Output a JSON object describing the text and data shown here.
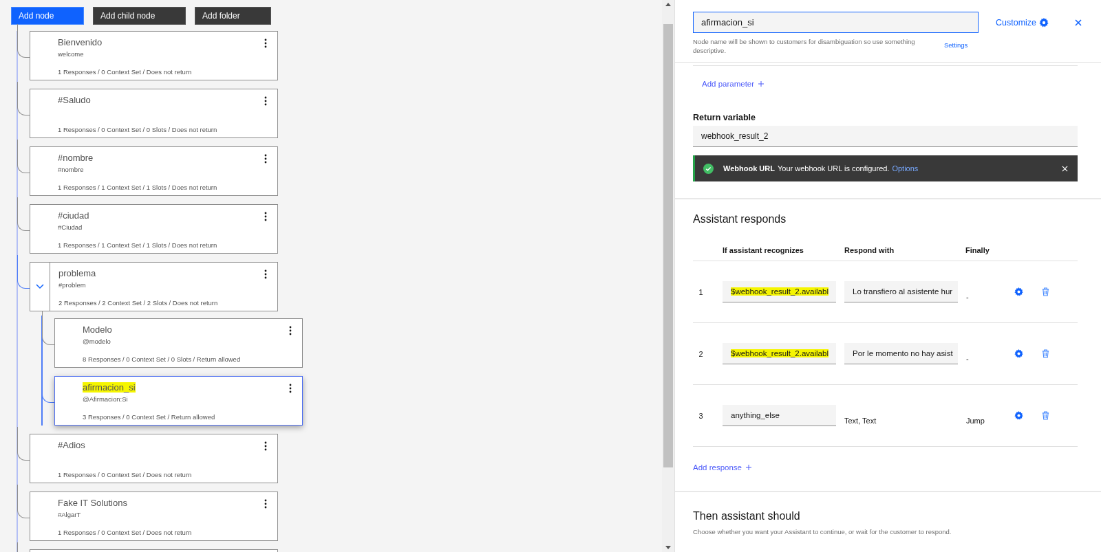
{
  "toolbar": [
    {
      "label": "Add node",
      "kind": "primary"
    },
    {
      "label": "Add child node",
      "kind": "dark"
    },
    {
      "label": "Add folder",
      "kind": "dark"
    }
  ],
  "nodes": [
    {
      "title": "Bienvenido",
      "condition": "welcome",
      "summary": "1 Responses / 0 Context Set / Does not return",
      "selected": false,
      "highlighted": false
    },
    {
      "title": "#Saludo",
      "summary": "1 Responses / 0 Context Set / 0 Slots / Does not return",
      "selected": false,
      "highlighted": false
    },
    {
      "title": "#nombre",
      "condition": "#nombre",
      "summary": "1 Responses / 1 Context Set / 1 Slots / Does not return",
      "selected": false,
      "highlighted": false
    },
    {
      "title": "#ciudad",
      "condition": "#Ciudad",
      "summary": "1 Responses / 1 Context Set / 1 Slots / Does not return",
      "selected": false,
      "highlighted": false
    },
    {
      "title": "problema",
      "condition": "#problem",
      "summary": "2 Responses / 2 Context Set / 2 Slots / Does not return",
      "selected": false,
      "highlighted": false,
      "expanded": true,
      "children": [
        {
          "title": "Modelo",
          "condition": "@modelo",
          "summary": "8 Responses / 0 Context Set / 0 Slots / Return allowed",
          "selected": false,
          "highlighted": false
        },
        {
          "title": "afirmacion_si",
          "condition": "@Afirmacion:Si",
          "summary": "3 Responses / 0 Context Set / Return allowed",
          "selected": true,
          "highlighted": true
        }
      ]
    },
    {
      "title": "#Adios",
      "summary": "1 Responses / 0 Context Set / Does not return",
      "selected": false,
      "highlighted": false
    },
    {
      "title": "Fake IT Solutions",
      "condition": "#AlgarT",
      "summary": "1 Responses / 0 Context Set / Does not return",
      "selected": false,
      "highlighted": false
    },
    {
      "selected": false,
      "highlighted": false
    }
  ],
  "panel": {
    "node_name": "afirmacion_si",
    "customize": "Customize",
    "hint": "Node name will be shown to customers for disambiguation so use something descriptive.",
    "settings": "Settings",
    "add_parameter": "Add parameter",
    "return_variable_label": "Return variable",
    "return_variable": "webhook_result_2",
    "notification": {
      "title": "Webhook URL",
      "message": "Your webhook URL is configured.",
      "link": "Options"
    },
    "responds_title": "Assistant responds",
    "columns": [
      "If assistant recognizes",
      "Respond with",
      "Finally"
    ],
    "rows": [
      {
        "number": "1",
        "condition": "$webhook_result_2.availabl",
        "highlighted": true,
        "response": "Lo transfiero al asistente hur",
        "kind": "field",
        "finally": "-"
      },
      {
        "number": "2",
        "condition": "$webhook_result_2.availabl",
        "highlighted": true,
        "response": "Por le momento no hay asist",
        "kind": "field",
        "finally": "-"
      },
      {
        "number": "3",
        "condition": "anything_else",
        "highlighted": false,
        "response": "Text, Text",
        "kind": "text",
        "finally": "Jump"
      }
    ],
    "add_response": "Add response",
    "then_title": "Then assistant should",
    "then_desc": "Choose whether you want your Assistant to continue, or wait for the customer to respond."
  }
}
